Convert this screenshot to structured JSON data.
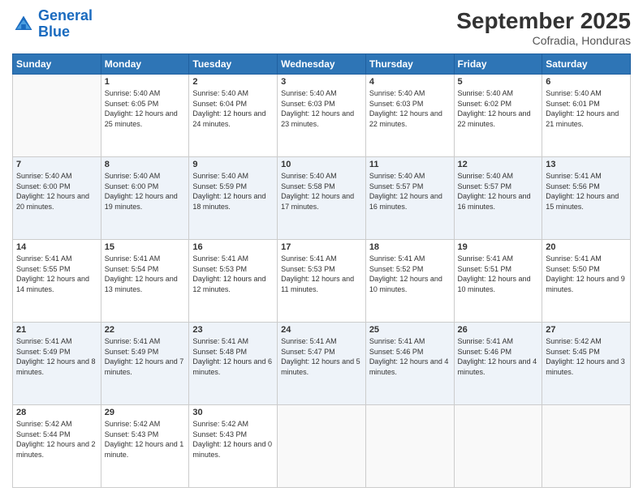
{
  "logo": {
    "text_general": "General",
    "text_blue": "Blue"
  },
  "header": {
    "month": "September 2025",
    "location": "Cofradia, Honduras"
  },
  "days_of_week": [
    "Sunday",
    "Monday",
    "Tuesday",
    "Wednesday",
    "Thursday",
    "Friday",
    "Saturday"
  ],
  "weeks": [
    [
      {
        "day": "",
        "sunrise": "",
        "sunset": "",
        "daylight": "",
        "empty": true
      },
      {
        "day": "1",
        "sunrise": "Sunrise: 5:40 AM",
        "sunset": "Sunset: 6:05 PM",
        "daylight": "Daylight: 12 hours and 25 minutes."
      },
      {
        "day": "2",
        "sunrise": "Sunrise: 5:40 AM",
        "sunset": "Sunset: 6:04 PM",
        "daylight": "Daylight: 12 hours and 24 minutes."
      },
      {
        "day": "3",
        "sunrise": "Sunrise: 5:40 AM",
        "sunset": "Sunset: 6:03 PM",
        "daylight": "Daylight: 12 hours and 23 minutes."
      },
      {
        "day": "4",
        "sunrise": "Sunrise: 5:40 AM",
        "sunset": "Sunset: 6:03 PM",
        "daylight": "Daylight: 12 hours and 22 minutes."
      },
      {
        "day": "5",
        "sunrise": "Sunrise: 5:40 AM",
        "sunset": "Sunset: 6:02 PM",
        "daylight": "Daylight: 12 hours and 22 minutes."
      },
      {
        "day": "6",
        "sunrise": "Sunrise: 5:40 AM",
        "sunset": "Sunset: 6:01 PM",
        "daylight": "Daylight: 12 hours and 21 minutes."
      }
    ],
    [
      {
        "day": "7",
        "sunrise": "Sunrise: 5:40 AM",
        "sunset": "Sunset: 6:00 PM",
        "daylight": "Daylight: 12 hours and 20 minutes."
      },
      {
        "day": "8",
        "sunrise": "Sunrise: 5:40 AM",
        "sunset": "Sunset: 6:00 PM",
        "daylight": "Daylight: 12 hours and 19 minutes."
      },
      {
        "day": "9",
        "sunrise": "Sunrise: 5:40 AM",
        "sunset": "Sunset: 5:59 PM",
        "daylight": "Daylight: 12 hours and 18 minutes."
      },
      {
        "day": "10",
        "sunrise": "Sunrise: 5:40 AM",
        "sunset": "Sunset: 5:58 PM",
        "daylight": "Daylight: 12 hours and 17 minutes."
      },
      {
        "day": "11",
        "sunrise": "Sunrise: 5:40 AM",
        "sunset": "Sunset: 5:57 PM",
        "daylight": "Daylight: 12 hours and 16 minutes."
      },
      {
        "day": "12",
        "sunrise": "Sunrise: 5:40 AM",
        "sunset": "Sunset: 5:57 PM",
        "daylight": "Daylight: 12 hours and 16 minutes."
      },
      {
        "day": "13",
        "sunrise": "Sunrise: 5:41 AM",
        "sunset": "Sunset: 5:56 PM",
        "daylight": "Daylight: 12 hours and 15 minutes."
      }
    ],
    [
      {
        "day": "14",
        "sunrise": "Sunrise: 5:41 AM",
        "sunset": "Sunset: 5:55 PM",
        "daylight": "Daylight: 12 hours and 14 minutes."
      },
      {
        "day": "15",
        "sunrise": "Sunrise: 5:41 AM",
        "sunset": "Sunset: 5:54 PM",
        "daylight": "Daylight: 12 hours and 13 minutes."
      },
      {
        "day": "16",
        "sunrise": "Sunrise: 5:41 AM",
        "sunset": "Sunset: 5:53 PM",
        "daylight": "Daylight: 12 hours and 12 minutes."
      },
      {
        "day": "17",
        "sunrise": "Sunrise: 5:41 AM",
        "sunset": "Sunset: 5:53 PM",
        "daylight": "Daylight: 12 hours and 11 minutes."
      },
      {
        "day": "18",
        "sunrise": "Sunrise: 5:41 AM",
        "sunset": "Sunset: 5:52 PM",
        "daylight": "Daylight: 12 hours and 10 minutes."
      },
      {
        "day": "19",
        "sunrise": "Sunrise: 5:41 AM",
        "sunset": "Sunset: 5:51 PM",
        "daylight": "Daylight: 12 hours and 10 minutes."
      },
      {
        "day": "20",
        "sunrise": "Sunrise: 5:41 AM",
        "sunset": "Sunset: 5:50 PM",
        "daylight": "Daylight: 12 hours and 9 minutes."
      }
    ],
    [
      {
        "day": "21",
        "sunrise": "Sunrise: 5:41 AM",
        "sunset": "Sunset: 5:49 PM",
        "daylight": "Daylight: 12 hours and 8 minutes."
      },
      {
        "day": "22",
        "sunrise": "Sunrise: 5:41 AM",
        "sunset": "Sunset: 5:49 PM",
        "daylight": "Daylight: 12 hours and 7 minutes."
      },
      {
        "day": "23",
        "sunrise": "Sunrise: 5:41 AM",
        "sunset": "Sunset: 5:48 PM",
        "daylight": "Daylight: 12 hours and 6 minutes."
      },
      {
        "day": "24",
        "sunrise": "Sunrise: 5:41 AM",
        "sunset": "Sunset: 5:47 PM",
        "daylight": "Daylight: 12 hours and 5 minutes."
      },
      {
        "day": "25",
        "sunrise": "Sunrise: 5:41 AM",
        "sunset": "Sunset: 5:46 PM",
        "daylight": "Daylight: 12 hours and 4 minutes."
      },
      {
        "day": "26",
        "sunrise": "Sunrise: 5:41 AM",
        "sunset": "Sunset: 5:46 PM",
        "daylight": "Daylight: 12 hours and 4 minutes."
      },
      {
        "day": "27",
        "sunrise": "Sunrise: 5:42 AM",
        "sunset": "Sunset: 5:45 PM",
        "daylight": "Daylight: 12 hours and 3 minutes."
      }
    ],
    [
      {
        "day": "28",
        "sunrise": "Sunrise: 5:42 AM",
        "sunset": "Sunset: 5:44 PM",
        "daylight": "Daylight: 12 hours and 2 minutes."
      },
      {
        "day": "29",
        "sunrise": "Sunrise: 5:42 AM",
        "sunset": "Sunset: 5:43 PM",
        "daylight": "Daylight: 12 hours and 1 minute."
      },
      {
        "day": "30",
        "sunrise": "Sunrise: 5:42 AM",
        "sunset": "Sunset: 5:43 PM",
        "daylight": "Daylight: 12 hours and 0 minutes."
      },
      {
        "day": "",
        "sunrise": "",
        "sunset": "",
        "daylight": "",
        "empty": true
      },
      {
        "day": "",
        "sunrise": "",
        "sunset": "",
        "daylight": "",
        "empty": true
      },
      {
        "day": "",
        "sunrise": "",
        "sunset": "",
        "daylight": "",
        "empty": true
      },
      {
        "day": "",
        "sunrise": "",
        "sunset": "",
        "daylight": "",
        "empty": true
      }
    ]
  ]
}
